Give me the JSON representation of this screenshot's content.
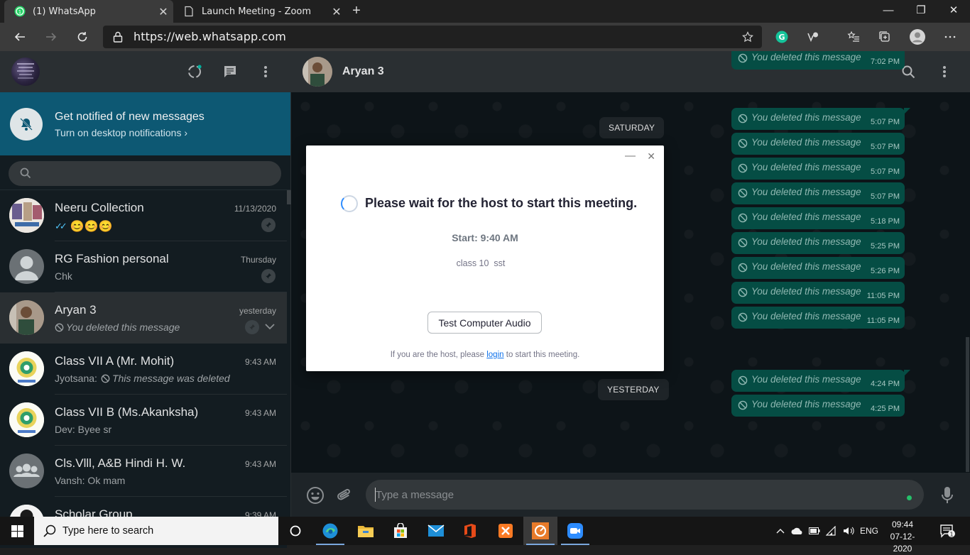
{
  "browser": {
    "tabs": [
      {
        "title": "(1) WhatsApp",
        "active": true
      },
      {
        "title": "Launch Meeting - Zoom",
        "active": false
      }
    ],
    "url_display": "https://web.whatsapp.com"
  },
  "sidebar": {
    "banner": {
      "title": "Get notified of new messages",
      "subtitle": "Turn on desktop notifications ›"
    },
    "search_placeholder": "",
    "chats": [
      {
        "name": "Neeru Collection",
        "time": "11/13/2020",
        "preview": "😊😊😊",
        "ticks": "✓✓",
        "pinned": true
      },
      {
        "name": "RG Fashion personal",
        "time": "Thursday",
        "preview": "Chk",
        "pinned": true
      },
      {
        "name": "Aryan 3",
        "time": "yesterday",
        "preview": "You deleted this message",
        "pinned": true
      },
      {
        "name": "Class VII A (Mr. Mohit)",
        "time": "9:43 AM",
        "sender": "Jyotsana:",
        "preview": "This message was deleted"
      },
      {
        "name": "Class VII B (Ms.Akanksha)",
        "time": "9:43 AM",
        "preview": "Dev: Byee sr"
      },
      {
        "name": "Cls.Vlll, A&B Hindi H. W.",
        "time": "9:43 AM",
        "preview": "Vansh: Ok mam"
      },
      {
        "name": "Scholar Group",
        "time": "9:39 AM"
      }
    ]
  },
  "conversation": {
    "contact_name": "Aryan 3",
    "date_chips": [
      "SATURDAY",
      "YESTERDAY"
    ],
    "deleted_text": "You deleted this message",
    "messages": [
      {
        "time": "7:02 PM"
      },
      {
        "time": "5:07 PM"
      },
      {
        "time": "5:07 PM"
      },
      {
        "time": "5:07 PM"
      },
      {
        "time": "5:07 PM"
      },
      {
        "time": "5:18 PM"
      },
      {
        "time": "5:25 PM"
      },
      {
        "time": "5:26 PM"
      },
      {
        "time": "11:05 PM"
      },
      {
        "time": "11:05 PM"
      },
      {
        "time": "4:24 PM"
      },
      {
        "time": "4:25 PM"
      }
    ],
    "composer_placeholder": "Type a message"
  },
  "zoom_dialog": {
    "message": "Please wait for the host to start this meeting.",
    "start": "Start: 9:40 AM",
    "topic": "class 10  sst",
    "button": "Test Computer Audio",
    "footer_prefix": "If you are the host, please",
    "footer_link": "login",
    "footer_suffix": "to start this meeting."
  },
  "taskbar": {
    "search_text": "Type here to search",
    "language": "ENG",
    "time": "09:44",
    "date": "07-12-2020",
    "notification_count": "1"
  },
  "colors": {
    "accent_green": "#00af9c",
    "bubble_out": "#054d44",
    "banner": "#0d5873",
    "zoom_blue": "#0e71eb"
  }
}
